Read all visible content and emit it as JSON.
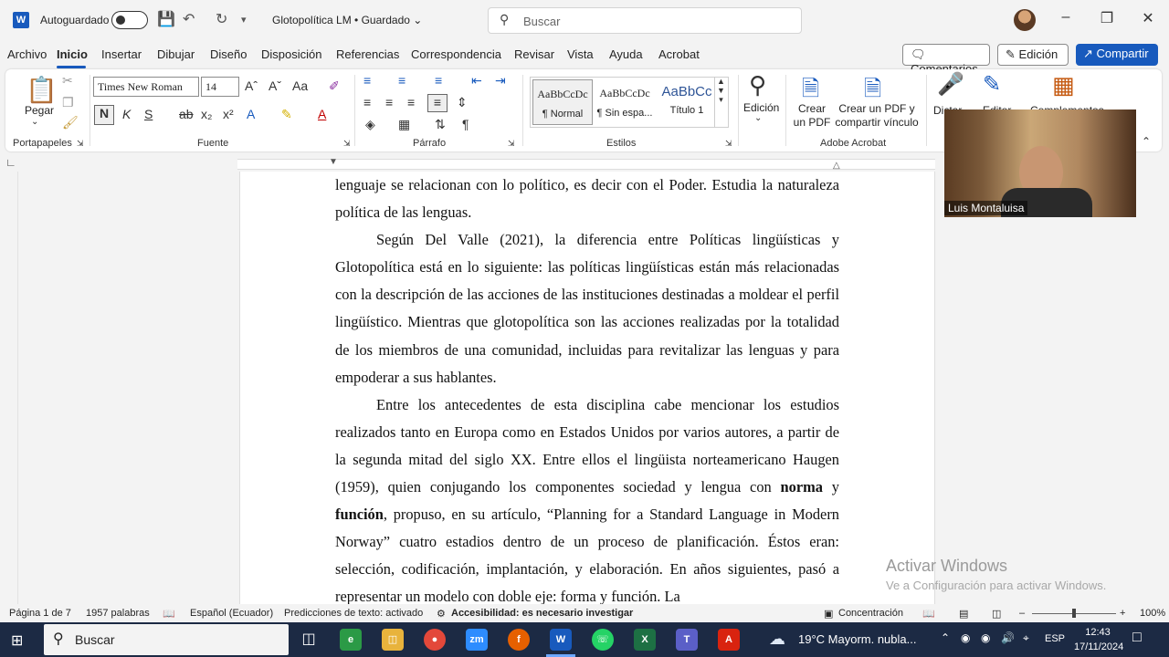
{
  "titlebar": {
    "app_icon": "W",
    "autosave_label": "Autoguardado",
    "doc_title": "Glotopolítica LM • Guardado",
    "search_placeholder": "Buscar"
  },
  "menu": [
    "Archivo",
    "Inicio",
    "Insertar",
    "Dibujar",
    "Diseño",
    "Disposición",
    "Referencias",
    "Correspondencia",
    "Revisar",
    "Vista",
    "Ayuda",
    "Acrobat"
  ],
  "actions": {
    "comments": "Comentarios",
    "editing": "Edición",
    "share": "Compartir"
  },
  "ribbon": {
    "clipboard": {
      "paste": "Pegar",
      "label": "Portapapeles"
    },
    "font": {
      "name": "Times New Roman",
      "size": "14",
      "label": "Fuente"
    },
    "paragraph": {
      "label": "Párrafo"
    },
    "styles": {
      "label": "Estilos",
      "items": [
        {
          "preview": "AaBbCcDc",
          "name": "¶ Normal"
        },
        {
          "preview": "AaBbCcDc",
          "name": "¶ Sin espa..."
        },
        {
          "preview": "AaBbCc",
          "name": "Título 1"
        }
      ]
    },
    "editing": {
      "label": "Edición"
    },
    "acrobat": {
      "create_pdf": "Crear un PDF",
      "create_share": "Crear un PDF y compartir vínculo",
      "label": "Adobe Acrobat"
    },
    "dictate": "Dictar",
    "editor": "Editor",
    "addins": "Complementos"
  },
  "document": {
    "lines": [
      "lenguaje se relacionan con lo político, es decir con el Poder. Estudia la naturaleza política de las lenguas.",
      "Según Del Valle (2021), la diferencia entre Políticas lingüísticas y Glotopolítica está en lo siguiente: las políticas lingüísticas están más relacionadas con la descripción de las acciones de las instituciones destinadas a moldear el perfil lingüístico. Mientras que glotopolítica son las acciones realizadas por la totalidad de los miembros de una comunidad, incluidas para revitalizar las lenguas y para empoderar a sus hablantes.",
      "Entre los antecedentes de esta disciplina cabe mencionar los estudios realizados tanto en Europa como en Estados Unidos por varios autores, a partir de la segunda mitad del siglo XX. Entre ellos el lingüista norteamericano Haugen (1959), quien conjugando los componentes sociedad y lengua con",
      "norma",
      " y ",
      "función",
      ", propuso, en su artículo, “Planning for a Standard Language in Modern Norway” cuatro estadios dentro de un proceso de planificación. Éstos eran: selección, codificación, implantación, y elaboración. En años siguientes, pasó a representar un modelo con doble eje: forma y función. La"
    ]
  },
  "video": {
    "participant": "Luis Montaluisa"
  },
  "watermark": {
    "line1": "Activar Windows",
    "line2": "Ve a Configuración para activar Windows."
  },
  "status": {
    "page": "Página 1 de 7",
    "words": "1957 palabras",
    "language": "Español (Ecuador)",
    "predictions": "Predicciones de texto: activado",
    "accessibility": "Accesibilidad: es necesario investigar",
    "focus": "Concentración",
    "zoom": "100%"
  },
  "taskbar": {
    "search": "Buscar",
    "weather": "19°C  Mayorm. nubla...",
    "lang": "ESP",
    "time": "12:43",
    "date": "17/11/2024"
  }
}
